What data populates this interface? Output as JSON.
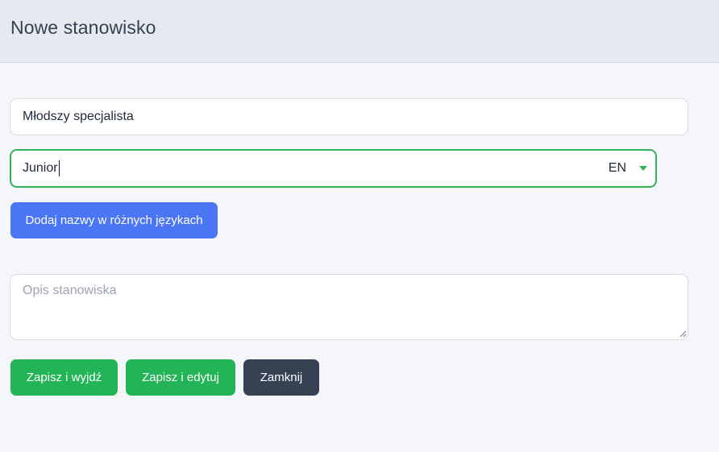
{
  "header": {
    "title": "Nowe stanowisko"
  },
  "form": {
    "name_value": "Młodszy specjalista",
    "translation": {
      "value": "Junior",
      "language": "EN"
    },
    "add_names_button": "Dodaj nazwy w różnych językach",
    "description": {
      "value": "",
      "placeholder": "Opis stanowiska"
    }
  },
  "actions": {
    "save_exit": "Zapisz i wyjdź",
    "save_edit": "Zapisz i edytuj",
    "close": "Zamknij"
  },
  "colors": {
    "primary": "#4a75f4",
    "success": "#22b457",
    "dark": "#364153",
    "focus_border": "#2fb457"
  }
}
